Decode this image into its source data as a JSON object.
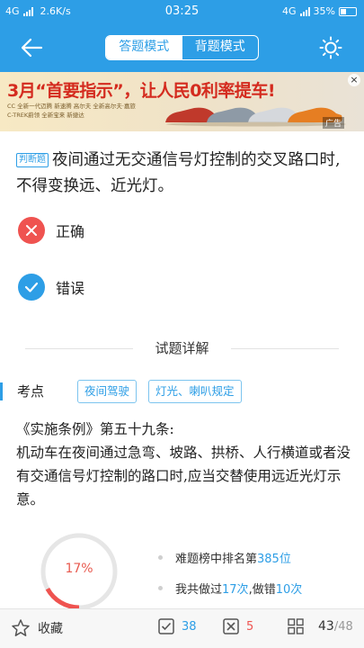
{
  "status_bar": {
    "network": "4G",
    "speed": "2.6K/s",
    "time": "03:25",
    "network_right": "4G",
    "battery": "35%"
  },
  "topbar": {
    "mode_answer": "答题模式",
    "mode_memorize": "背题模式",
    "active_mode": "答题模式"
  },
  "ad": {
    "headline": "3月“首要指示”，让人民0利率提车!",
    "line1": "CC 全新一代迈腾 新速腾 高尔夫 全新高尔夫·嘉旅",
    "line2": "C-TREK蔚领 全新宝来 新捷达",
    "tag": "广告"
  },
  "question": {
    "type_label": "判断题",
    "text": "夜间通过无交通信号灯控制的交叉路口时,不得变换远、近光灯。"
  },
  "options": [
    {
      "label": "正确",
      "state": "wrong"
    },
    {
      "label": "错误",
      "state": "correct"
    }
  ],
  "detail": {
    "title": "试题详解",
    "knowledge_label": "考点",
    "tags": [
      "夜间驾驶",
      "灯光、喇叭规定"
    ],
    "explanation": "《实施条例》第五十九条:\n机动车在夜间通过急弯、坡路、拱桥、人行横道或者没有交通信号灯控制的路口时,应当交替使用远近光灯示意。"
  },
  "stats": {
    "error_rate_text": "17%",
    "error_rate": 0.17,
    "rank_prefix": "难题榜中排名第",
    "rank_value": "385位",
    "done_prefix": "我共做过",
    "done_value": "17次",
    "done_middle": ",做错",
    "wrong_value": "10次"
  },
  "bottom_bar": {
    "favorite_label": "收藏",
    "correct_count": "38",
    "wrong_count": "5",
    "progress_current": "43",
    "progress_total": "/48"
  },
  "colors": {
    "primary": "#2d9ee6",
    "wrong": "#ef5350",
    "ad_headline": "#d42b1f"
  }
}
